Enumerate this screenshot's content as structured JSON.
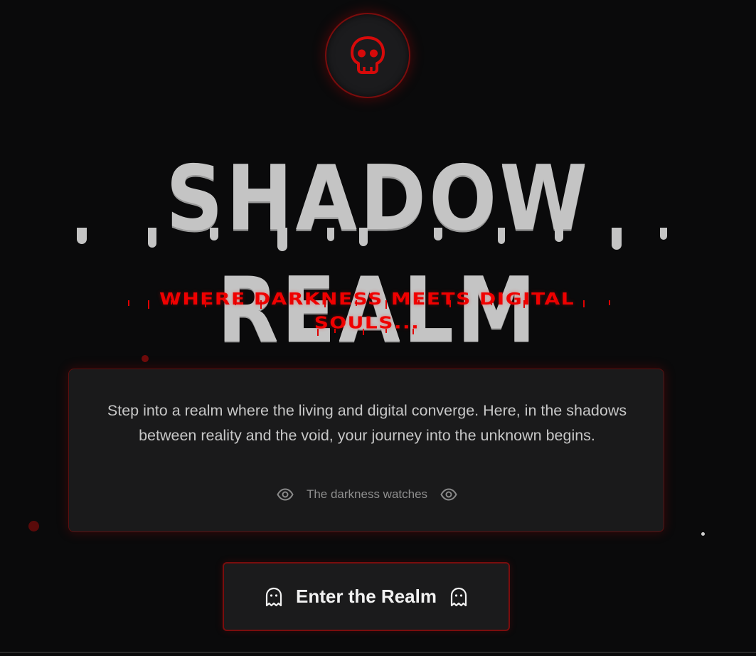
{
  "hero": {
    "badge_icon": "skull-icon",
    "title": "SHADOW REALM",
    "subtitle": "WHERE DARKNESS MEETS DIGITAL SOULS..."
  },
  "story_card": {
    "text": "Step into a realm where the living and digital converge. Here, in the shadows between reality and the void, your journey into the unknown begins.",
    "watch_label": "The darkness watches",
    "left_icon": "eye-icon",
    "right_icon": "eye-icon"
  },
  "cta": {
    "label": "Enter the Realm",
    "left_icon": "ghost-icon",
    "right_icon": "ghost-icon"
  },
  "colors": {
    "background": "#0a0a0b",
    "accent_red": "#f00000",
    "title_gray": "#c4c4c4",
    "card_border": "#5c1010"
  }
}
